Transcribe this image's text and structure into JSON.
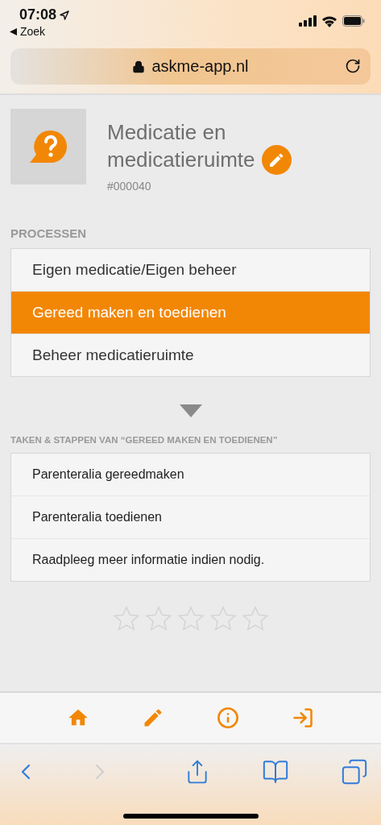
{
  "status_bar": {
    "time": "07:08",
    "back_label": "Zoek"
  },
  "browser": {
    "url": "askme-app.nl"
  },
  "header": {
    "title": "Medicatie en medicatieruimte",
    "id": "#000040"
  },
  "processes": {
    "heading": "PROCESSEN",
    "items": [
      {
        "label": "Eigen medicatie/Eigen beheer",
        "selected": false
      },
      {
        "label": "Gereed maken en toedienen",
        "selected": true
      },
      {
        "label": "Beheer medicatieruimte",
        "selected": false
      }
    ]
  },
  "tasks": {
    "heading": "TAKEN & STAPPEN VAN “GEREED MAKEN EN TOEDIENEN”",
    "items": [
      {
        "label": "Parenteralia gereedmaken"
      },
      {
        "label": "Parenteralia toedienen"
      },
      {
        "label": "Raadpleeg meer informatie indien nodig."
      }
    ]
  },
  "rating": {
    "stars": 0
  },
  "safari_toolbar": {
    "back": {
      "disabled": false
    },
    "forward": {
      "disabled": true
    }
  }
}
